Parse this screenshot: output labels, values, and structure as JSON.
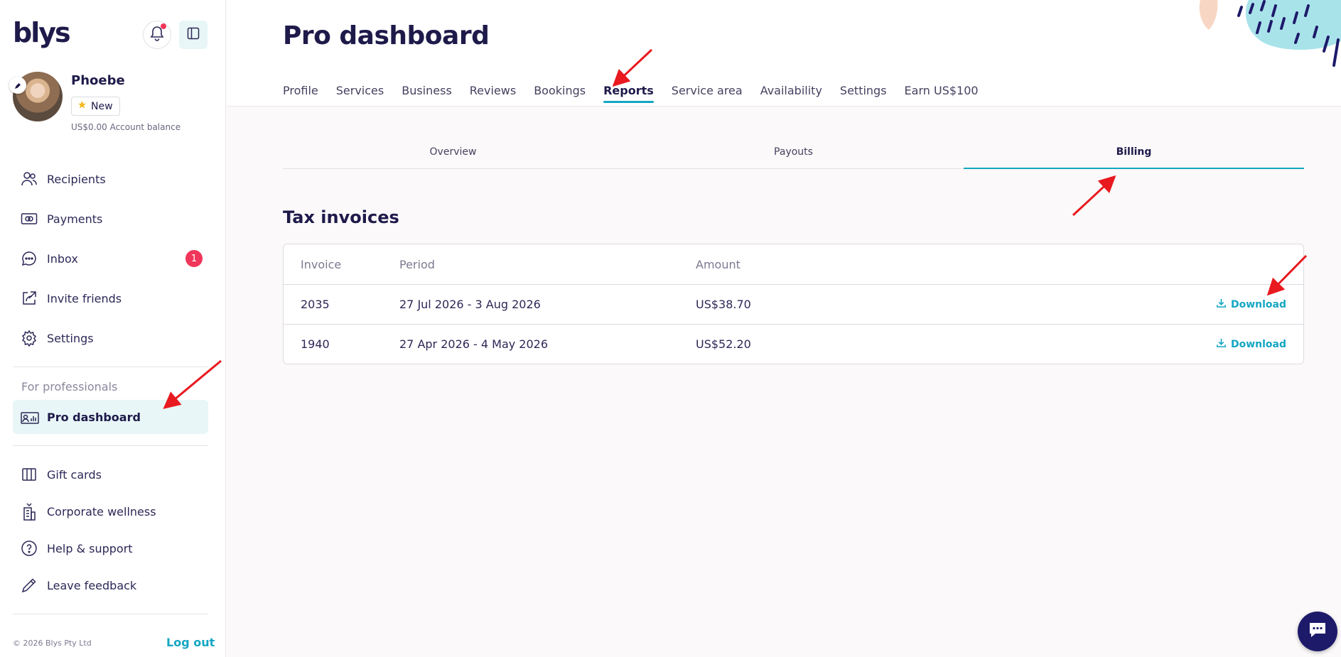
{
  "sidebar": {
    "logo": "blys",
    "user": {
      "name": "Phoebe",
      "badge": "New",
      "balance": "US$0.00 Account balance"
    },
    "items": [
      {
        "label": "Recipients",
        "icon": "users-icon"
      },
      {
        "label": "Payments",
        "icon": "cash-icon"
      },
      {
        "label": "Inbox",
        "icon": "chat-bubble-icon",
        "badge": "1"
      },
      {
        "label": "Invite friends",
        "icon": "share-icon"
      },
      {
        "label": "Settings",
        "icon": "gear-icon"
      }
    ],
    "section_label": "For professionals",
    "pro_item": {
      "label": "Pro dashboard",
      "icon": "dashboard-icon"
    },
    "bottom_items": [
      {
        "label": "Gift cards",
        "icon": "gift-icon"
      },
      {
        "label": "Corporate wellness",
        "icon": "building-icon"
      },
      {
        "label": "Help & support",
        "icon": "help-icon"
      },
      {
        "label": "Leave feedback",
        "icon": "pencil-icon"
      }
    ],
    "copyright": "© 2026 Blys Pty Ltd",
    "logout": "Log out"
  },
  "main": {
    "title": "Pro dashboard",
    "tabs": [
      "Profile",
      "Services",
      "Business",
      "Reviews",
      "Bookings",
      "Reports",
      "Service area",
      "Availability",
      "Settings",
      "Earn US$100"
    ],
    "active_tab": "Reports",
    "subtabs": [
      "Overview",
      "Payouts",
      "Billing"
    ],
    "active_subtab": "Billing",
    "section_title": "Tax invoices",
    "table": {
      "headers": [
        "Invoice",
        "Period",
        "Amount"
      ],
      "rows": [
        {
          "invoice": "2035",
          "period": "27 Jul 2026 - 3 Aug 2026",
          "amount": "US$38.70",
          "action": "Download"
        },
        {
          "invoice": "1940",
          "period": "27 Apr 2026 - 4 May 2026",
          "amount": "US$52.20",
          "action": "Download"
        }
      ]
    }
  },
  "colors": {
    "accent": "#14a6c3",
    "brand": "#1e1a4a",
    "alert": "#f0365a",
    "active_bg": "#e8f6f7",
    "annotation": "#e8191f"
  }
}
